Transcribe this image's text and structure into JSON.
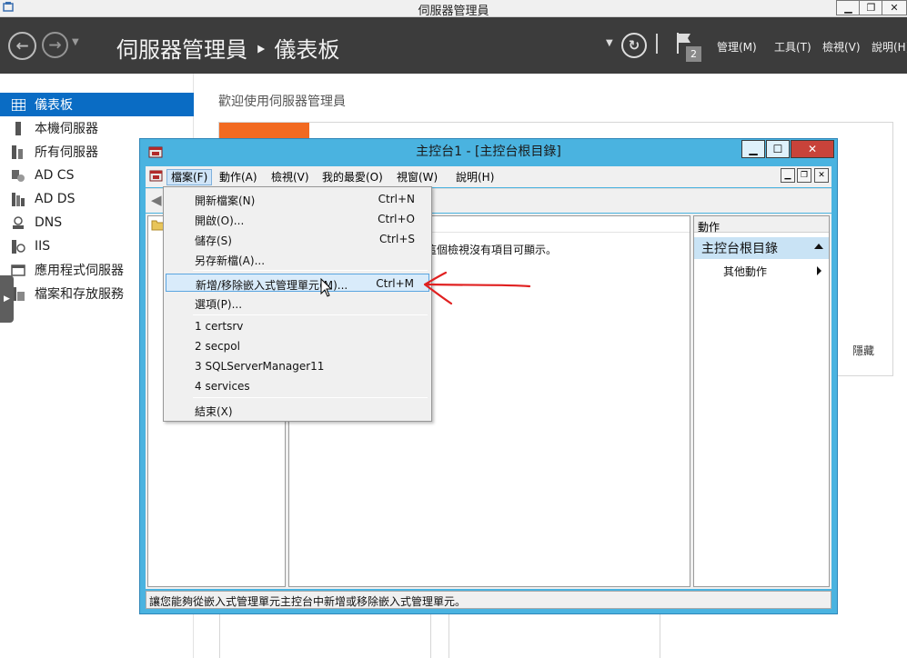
{
  "server_manager": {
    "title": "伺服器管理員",
    "breadcrumb": "伺服器管理員 ‣ 儀表板",
    "notification_count": "2",
    "menus": [
      "管理(M)",
      "工具(T)",
      "檢視(V)",
      "說明(H)"
    ],
    "nav": [
      {
        "label": "儀表板",
        "icon": "dashboard-grid-icon",
        "active": true
      },
      {
        "label": "本機伺服器",
        "icon": "server-icon"
      },
      {
        "label": "所有伺服器",
        "icon": "servers-icon"
      },
      {
        "label": "AD CS",
        "icon": "certificate-services-icon"
      },
      {
        "label": "AD DS",
        "icon": "directory-services-icon"
      },
      {
        "label": "DNS",
        "icon": "dns-icon"
      },
      {
        "label": "IIS",
        "icon": "iis-icon"
      },
      {
        "label": "應用程式伺服器",
        "icon": "application-server-icon"
      },
      {
        "label": "檔案和存放服務",
        "icon": "file-storage-icon"
      }
    ],
    "welcome": "歡迎使用伺服器管理員",
    "hide_link": "隱藏",
    "colors": {
      "header_bg": "#3c3c3c",
      "nav_active": "#0a6cc4",
      "tile_orange": "#f26a21"
    }
  },
  "mmc": {
    "title": "主控台1 - [主控台根目錄]",
    "menus": [
      "檔案(F)",
      "動作(A)",
      "檢視(V)",
      "我的最愛(O)",
      "視窗(W)",
      "說明(H)"
    ],
    "result_empty": "這個檢視沒有項目可顯示。",
    "actions": {
      "header": "動作",
      "section": "主控台根目錄",
      "more": "其他動作"
    },
    "status": "讓您能夠從嵌入式管理單元主控台中新增或移除嵌入式管理單元。",
    "file_menu": [
      {
        "label": "開新檔案(N)",
        "shortcut": "Ctrl+N"
      },
      {
        "label": "開啟(O)...",
        "shortcut": "Ctrl+O"
      },
      {
        "label": "儲存(S)",
        "shortcut": "Ctrl+S"
      },
      {
        "label": "另存新檔(A)...",
        "shortcut": ""
      },
      {
        "label": "新增/移除嵌入式管理單元(M)...",
        "shortcut": "Ctrl+M",
        "highlighted": true
      },
      {
        "label": "選項(P)...",
        "shortcut": ""
      },
      {
        "label": "1 certsrv",
        "shortcut": ""
      },
      {
        "label": "2 secpol",
        "shortcut": ""
      },
      {
        "label": "3 SQLServerManager11",
        "shortcut": ""
      },
      {
        "label": "4 services",
        "shortcut": ""
      },
      {
        "label": "結束(X)",
        "shortcut": ""
      }
    ],
    "colors": {
      "frame": "#4ab3e0",
      "highlight": "#d9ebfa",
      "close": "#c8433a",
      "annotation": "#e02020"
    }
  }
}
